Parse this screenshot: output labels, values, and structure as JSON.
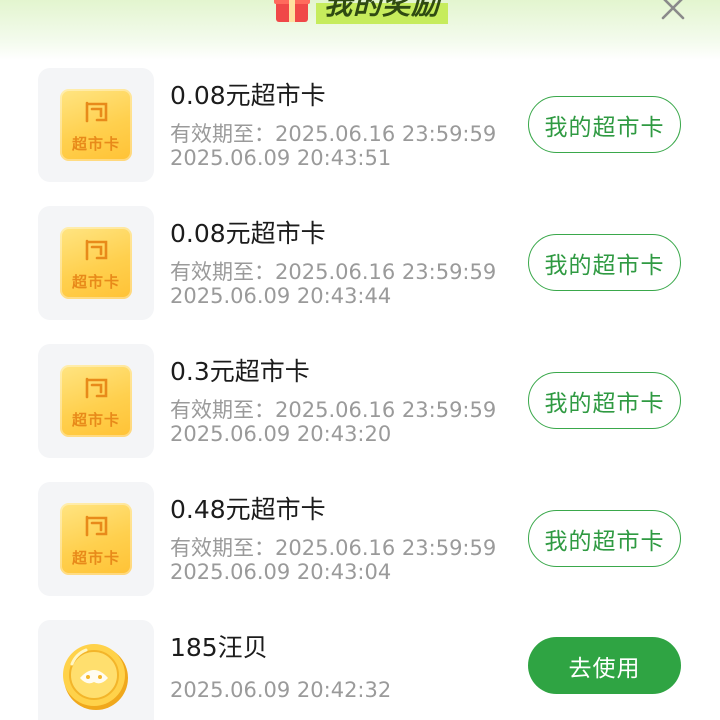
{
  "header": {
    "title": "我的奖励",
    "gift_icon": "gift-icon",
    "close_icon": "close-icon"
  },
  "card_label": "超市卡",
  "rewards": [
    {
      "name": "0.08元超市卡",
      "expiry": "有效期至：2025.06.16 23:59:59",
      "time": "2025.06.09 20:43:51",
      "action": "我的超市卡",
      "icon": "supermarket-card-icon"
    },
    {
      "name": "0.08元超市卡",
      "expiry": "有效期至：2025.06.16 23:59:59",
      "time": "2025.06.09 20:43:44",
      "action": "我的超市卡",
      "icon": "supermarket-card-icon"
    },
    {
      "name": "0.3元超市卡",
      "expiry": "有效期至：2025.06.16 23:59:59",
      "time": "2025.06.09 20:43:20",
      "action": "我的超市卡",
      "icon": "supermarket-card-icon"
    },
    {
      "name": "0.48元超市卡",
      "expiry": "有效期至：2025.06.16 23:59:59",
      "time": "2025.06.09 20:43:04",
      "action": "我的超市卡",
      "icon": "supermarket-card-icon"
    },
    {
      "name": "185汪贝",
      "time": "2025.06.09 20:42:32",
      "action": "去使用",
      "icon": "coin-icon"
    }
  ],
  "colors": {
    "accent_green": "#2fa443",
    "card_gold": "#ffd04e",
    "title_highlight": "#c6ec5c"
  }
}
